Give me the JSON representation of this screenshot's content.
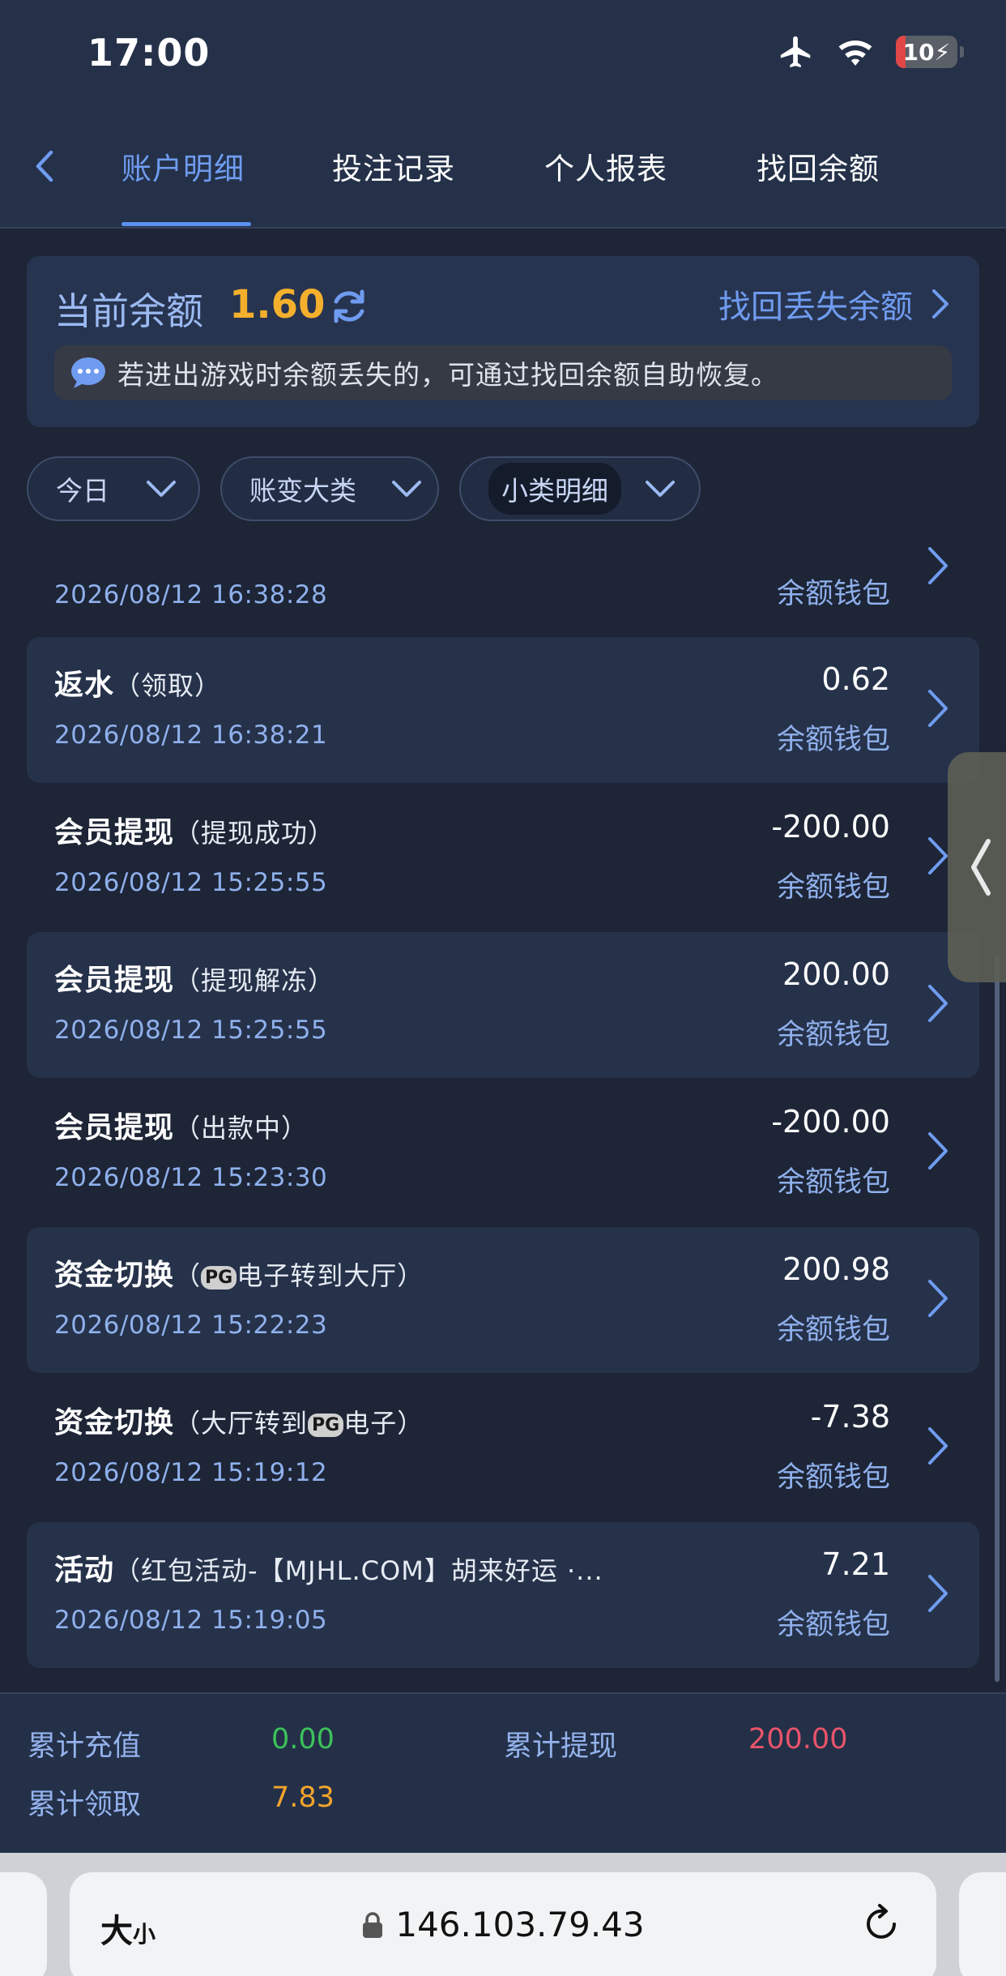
{
  "status_bar": {
    "time": "17:00",
    "battery": "10"
  },
  "tabs": [
    {
      "label": "账户明细",
      "active": true
    },
    {
      "label": "投注记录",
      "active": false
    },
    {
      "label": "个人报表",
      "active": false
    },
    {
      "label": "找回余额",
      "active": false
    }
  ],
  "balance": {
    "label": "当前余额",
    "value": "1.60",
    "recover_link": "找回丢失余额",
    "notice": "若进出游戏时余额丢失的，可通过找回余额自助恢复。"
  },
  "filters": [
    {
      "label": "今日"
    },
    {
      "label": "账变大类"
    },
    {
      "label": "小类明细"
    }
  ],
  "records": [
    {
      "title": "",
      "sub": "",
      "date": "2026/08/12 16:38:28",
      "amount": "",
      "wallet": "余额钱包"
    },
    {
      "title": "返水",
      "sub": "（领取）",
      "date": "2026/08/12 16:38:21",
      "amount": "0.62",
      "wallet": "余额钱包"
    },
    {
      "title": "会员提现",
      "sub": "（提现成功）",
      "date": "2026/08/12 15:25:55",
      "amount": "-200.00",
      "wallet": "余额钱包"
    },
    {
      "title": "会员提现",
      "sub": "（提现解冻）",
      "date": "2026/08/12 15:25:55",
      "amount": "200.00",
      "wallet": "余额钱包"
    },
    {
      "title": "会员提现",
      "sub": "（出款中）",
      "date": "2026/08/12 15:23:30",
      "amount": "-200.00",
      "wallet": "余额钱包"
    },
    {
      "title": "资金切换",
      "sub_pre": "（",
      "pg": "PG",
      "sub_post": "电子转到大厅）",
      "date": "2026/08/12 15:22:23",
      "amount": "200.98",
      "wallet": "余额钱包"
    },
    {
      "title": "资金切换",
      "sub_pre": "（大厅转到",
      "pg": "PG",
      "sub_post": "电子）",
      "date": "2026/08/12 15:19:12",
      "amount": "-7.38",
      "wallet": "余额钱包"
    },
    {
      "title": "活动",
      "sub": "（红包活动-【MJHL.COM】胡来好运 ·...",
      "date": "2026/08/12 15:19:05",
      "amount": "7.21",
      "wallet": "余额钱包"
    }
  ],
  "summary": {
    "recharge_label": "累计充值",
    "recharge_value": "0.00",
    "withdraw_label": "累计提现",
    "withdraw_value": "200.00",
    "claim_label": "累计领取",
    "claim_value": "7.83"
  },
  "browser": {
    "text_size_big": "大",
    "text_size_small": "小",
    "url": "146.103.79.43"
  },
  "colors": {
    "accent": "#6f9cf0",
    "balance": "#f4b02c",
    "recharge": "#3cc25a",
    "withdraw": "#e8546a",
    "claim": "#f4a42c"
  }
}
